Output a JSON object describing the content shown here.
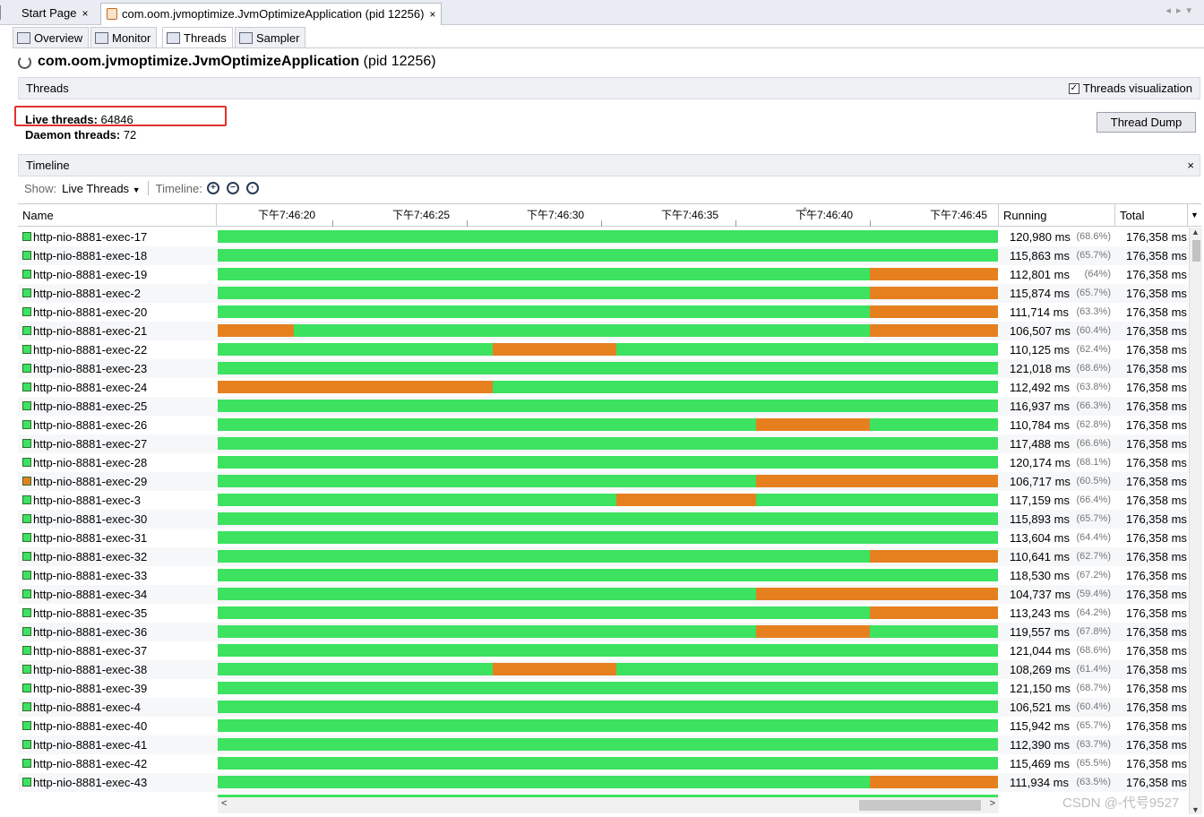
{
  "doc_tabs": [
    {
      "label": "Start Page",
      "close": "×"
    },
    {
      "label": "com.oom.jvmoptimize.JvmOptimizeApplication (pid 12256)",
      "close": "×"
    }
  ],
  "sub_tabs": [
    {
      "label": "Overview",
      "icon": "overview-icon"
    },
    {
      "label": "Monitor",
      "icon": "monitor-icon"
    },
    {
      "label": "Threads",
      "icon": "threads-icon"
    },
    {
      "label": "Sampler",
      "icon": "sampler-icon"
    }
  ],
  "app": {
    "name": "com.oom.jvmoptimize.JvmOptimizeApplication",
    "pid": "(pid 12256)"
  },
  "threads_section": {
    "title": "Threads",
    "viz_label": "Threads visualization",
    "viz_checked": true
  },
  "stats": {
    "live_label": "Live threads:",
    "live_value": "64846",
    "daemon_label": "Daemon threads:",
    "daemon_value": "72",
    "dump_button": "Thread Dump"
  },
  "timeline_section": {
    "title": "Timeline",
    "close": "×"
  },
  "toolbar": {
    "show_label": "Show:",
    "show_value": "Live Threads",
    "timeline_label": "Timeline:"
  },
  "columns": {
    "name": "Name",
    "running": "Running",
    "total": "Total"
  },
  "time_ticks": [
    "下午7:46:20",
    "下午7:46:25",
    "下午7:46:30",
    "下午7:46:35",
    "下午7:46:40",
    "下午7:46:45"
  ],
  "colors": {
    "running": "#3ce260",
    "other": "#e6801f",
    "highlight": "#e5302a"
  },
  "threads": [
    {
      "name": "http-nio-8881-exec-17",
      "running": "120,980 ms",
      "pct": "(68.6%)",
      "total": "176,358 ms",
      "state": "running",
      "segments": []
    },
    {
      "name": "http-nio-8881-exec-18",
      "running": "115,863 ms",
      "pct": "(65.7%)",
      "total": "176,358 ms",
      "state": "running",
      "segments": []
    },
    {
      "name": "http-nio-8881-exec-19",
      "running": "112,801 ms",
      "pct": "(64%)",
      "total": "176,358 ms",
      "state": "running",
      "segments": [
        [
          0.836,
          1
        ]
      ]
    },
    {
      "name": "http-nio-8881-exec-2",
      "running": "115,874 ms",
      "pct": "(65.7%)",
      "total": "176,358 ms",
      "state": "running",
      "segments": [
        [
          0.836,
          1
        ]
      ]
    },
    {
      "name": "http-nio-8881-exec-20",
      "running": "111,714 ms",
      "pct": "(63.3%)",
      "total": "176,358 ms",
      "state": "running",
      "segments": [
        [
          0.836,
          1
        ]
      ]
    },
    {
      "name": "http-nio-8881-exec-21",
      "running": "106,507 ms",
      "pct": "(60.4%)",
      "total": "176,358 ms",
      "state": "running",
      "segments": [
        [
          0,
          0.098
        ],
        [
          0.836,
          1
        ]
      ]
    },
    {
      "name": "http-nio-8881-exec-22",
      "running": "110,125 ms",
      "pct": "(62.4%)",
      "total": "176,358 ms",
      "state": "running",
      "segments": [
        [
          0.352,
          0.511
        ]
      ]
    },
    {
      "name": "http-nio-8881-exec-23",
      "running": "121,018 ms",
      "pct": "(68.6%)",
      "total": "176,358 ms",
      "state": "running",
      "segments": []
    },
    {
      "name": "http-nio-8881-exec-24",
      "running": "112,492 ms",
      "pct": "(63.8%)",
      "total": "176,358 ms",
      "state": "running",
      "segments": [
        [
          0,
          0.352
        ]
      ]
    },
    {
      "name": "http-nio-8881-exec-25",
      "running": "116,937 ms",
      "pct": "(66.3%)",
      "total": "176,358 ms",
      "state": "running",
      "segments": []
    },
    {
      "name": "http-nio-8881-exec-26",
      "running": "110,784 ms",
      "pct": "(62.8%)",
      "total": "176,358 ms",
      "state": "running",
      "segments": [
        [
          0.69,
          0.836
        ]
      ]
    },
    {
      "name": "http-nio-8881-exec-27",
      "running": "117,488 ms",
      "pct": "(66.6%)",
      "total": "176,358 ms",
      "state": "running",
      "segments": []
    },
    {
      "name": "http-nio-8881-exec-28",
      "running": "120,174 ms",
      "pct": "(68.1%)",
      "total": "176,358 ms",
      "state": "running",
      "segments": []
    },
    {
      "name": "http-nio-8881-exec-29",
      "running": "106,717 ms",
      "pct": "(60.5%)",
      "total": "176,358 ms",
      "state": "other",
      "segments": [
        [
          0.69,
          1
        ]
      ]
    },
    {
      "name": "http-nio-8881-exec-3",
      "running": "117,159 ms",
      "pct": "(66.4%)",
      "total": "176,358 ms",
      "state": "running",
      "segments": [
        [
          0.511,
          0.69
        ]
      ]
    },
    {
      "name": "http-nio-8881-exec-30",
      "running": "115,893 ms",
      "pct": "(65.7%)",
      "total": "176,358 ms",
      "state": "running",
      "segments": []
    },
    {
      "name": "http-nio-8881-exec-31",
      "running": "113,604 ms",
      "pct": "(64.4%)",
      "total": "176,358 ms",
      "state": "running",
      "segments": []
    },
    {
      "name": "http-nio-8881-exec-32",
      "running": "110,641 ms",
      "pct": "(62.7%)",
      "total": "176,358 ms",
      "state": "running",
      "segments": [
        [
          0.836,
          1
        ]
      ]
    },
    {
      "name": "http-nio-8881-exec-33",
      "running": "118,530 ms",
      "pct": "(67.2%)",
      "total": "176,358 ms",
      "state": "running",
      "segments": []
    },
    {
      "name": "http-nio-8881-exec-34",
      "running": "104,737 ms",
      "pct": "(59.4%)",
      "total": "176,358 ms",
      "state": "running",
      "segments": [
        [
          0.69,
          1
        ]
      ]
    },
    {
      "name": "http-nio-8881-exec-35",
      "running": "113,243 ms",
      "pct": "(64.2%)",
      "total": "176,358 ms",
      "state": "running",
      "segments": [
        [
          0.836,
          1
        ]
      ]
    },
    {
      "name": "http-nio-8881-exec-36",
      "running": "119,557 ms",
      "pct": "(67.8%)",
      "total": "176,358 ms",
      "state": "running",
      "segments": [
        [
          0.69,
          0.836
        ]
      ]
    },
    {
      "name": "http-nio-8881-exec-37",
      "running": "121,044 ms",
      "pct": "(68.6%)",
      "total": "176,358 ms",
      "state": "running",
      "segments": []
    },
    {
      "name": "http-nio-8881-exec-38",
      "running": "108,269 ms",
      "pct": "(61.4%)",
      "total": "176,358 ms",
      "state": "running",
      "segments": [
        [
          0.352,
          0.511
        ]
      ]
    },
    {
      "name": "http-nio-8881-exec-39",
      "running": "121,150 ms",
      "pct": "(68.7%)",
      "total": "176,358 ms",
      "state": "running",
      "segments": []
    },
    {
      "name": "http-nio-8881-exec-4",
      "running": "106,521 ms",
      "pct": "(60.4%)",
      "total": "176,358 ms",
      "state": "running",
      "segments": []
    },
    {
      "name": "http-nio-8881-exec-40",
      "running": "115,942 ms",
      "pct": "(65.7%)",
      "total": "176,358 ms",
      "state": "running",
      "segments": []
    },
    {
      "name": "http-nio-8881-exec-41",
      "running": "112,390 ms",
      "pct": "(63.7%)",
      "total": "176,358 ms",
      "state": "running",
      "segments": []
    },
    {
      "name": "http-nio-8881-exec-42",
      "running": "115,469 ms",
      "pct": "(65.5%)",
      "total": "176,358 ms",
      "state": "running",
      "segments": []
    },
    {
      "name": "http-nio-8881-exec-43",
      "running": "111,934 ms",
      "pct": "(63.5%)",
      "total": "176,358 ms",
      "state": "running",
      "segments": [
        [
          0.836,
          1
        ]
      ]
    }
  ],
  "watermark": "CSDN @-代号9527"
}
